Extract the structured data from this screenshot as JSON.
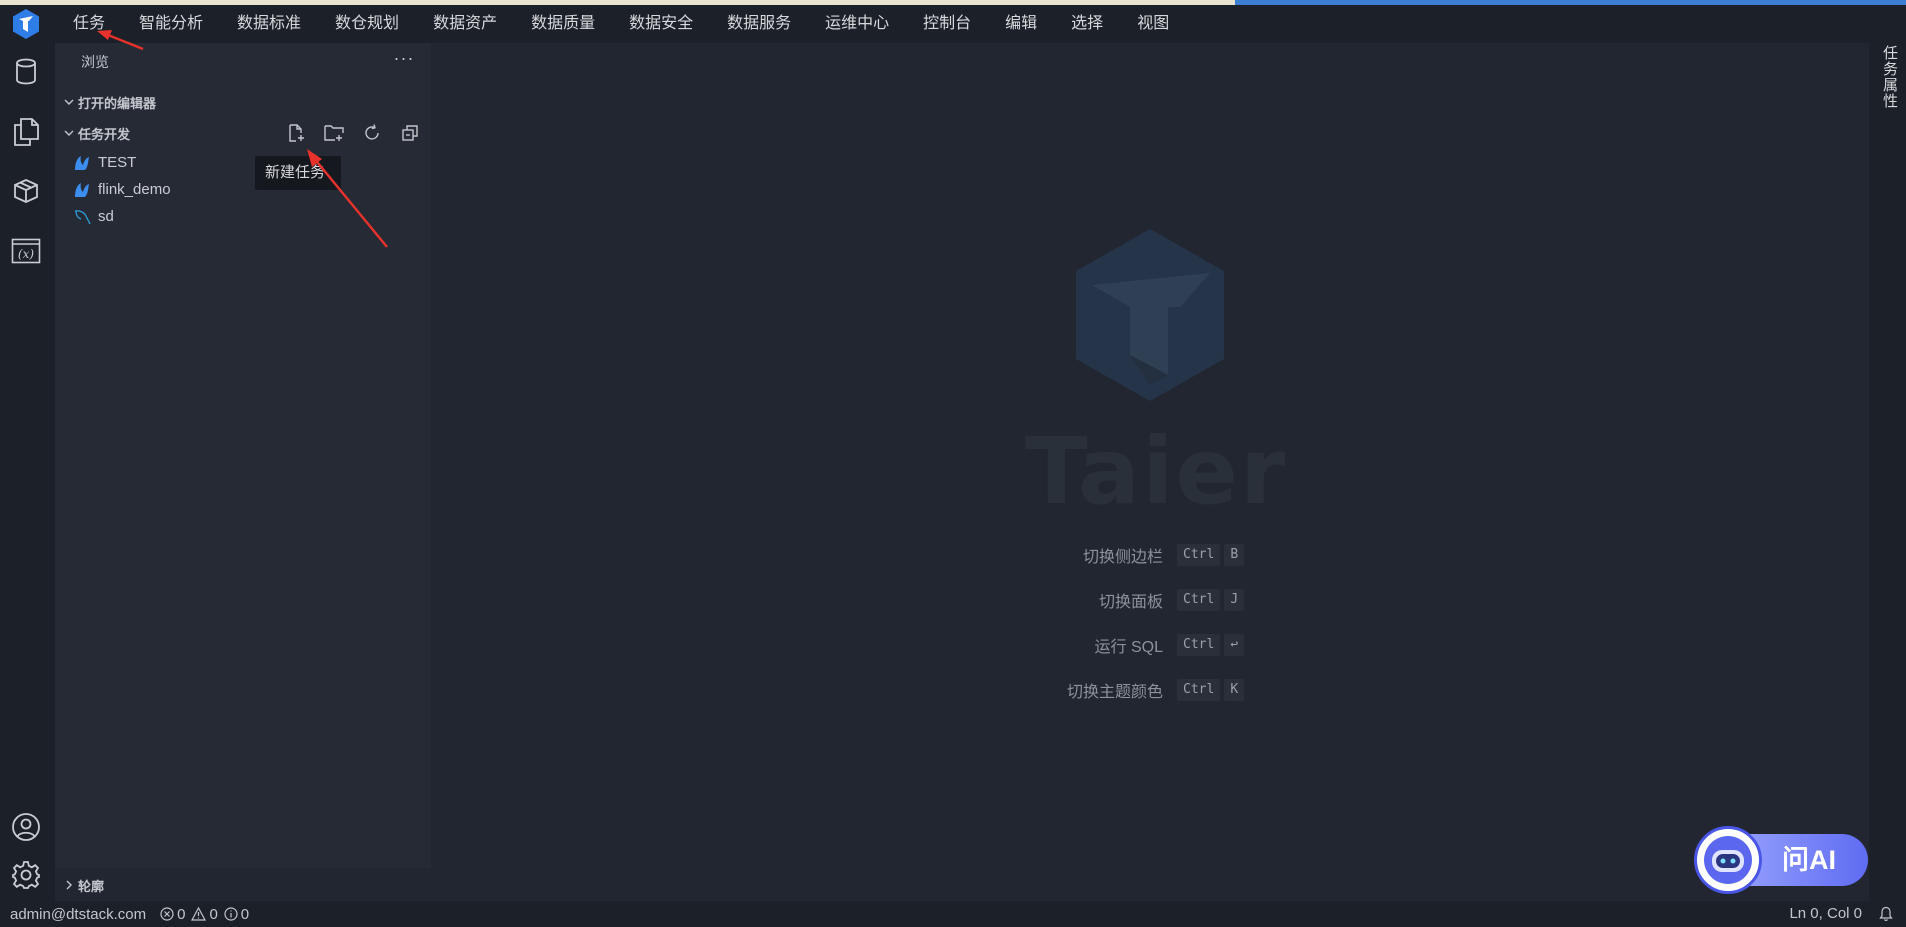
{
  "menu": {
    "items": [
      "任务",
      "智能分析",
      "数据标准",
      "数仓规划",
      "数据资产",
      "数据质量",
      "数据安全",
      "数据服务",
      "运维中心",
      "控制台",
      "编辑",
      "选择",
      "视图"
    ]
  },
  "activity": {
    "icons": [
      "database-icon",
      "files-icon",
      "package-icon",
      "variable-icon",
      "account-icon",
      "settings-icon"
    ]
  },
  "sidebar": {
    "title": "浏览",
    "more": "···",
    "open_editors": "打开的编辑器",
    "task_dev": "任务开发",
    "tree": [
      {
        "label": "TEST",
        "icon": "flink-icon"
      },
      {
        "label": "flink_demo",
        "icon": "flink-icon"
      },
      {
        "label": "sd",
        "icon": "sql-icon"
      }
    ],
    "tooltip": "新建任务",
    "outline": "轮廓"
  },
  "editor": {
    "watermark": "Taier",
    "shortcuts": [
      {
        "label": "切换侧边栏",
        "keys": [
          "Ctrl",
          "B"
        ]
      },
      {
        "label": "切换面板",
        "keys": [
          "Ctrl",
          "J"
        ]
      },
      {
        "label": "运行 SQL",
        "keys": [
          "Ctrl",
          "↩"
        ]
      },
      {
        "label": "切换主题颜色",
        "keys": [
          "Ctrl",
          "K"
        ]
      }
    ]
  },
  "auxbar": {
    "tab": "任务属性"
  },
  "ai": {
    "label": "问AI"
  },
  "status": {
    "user": "admin@dtstack.com",
    "errors": "0",
    "warnings": "0",
    "infos": "0",
    "position": "Ln 0, Col 0"
  },
  "colors": {
    "accent": "#3e7fd6",
    "background": "#212630",
    "sidebar": "#252a34",
    "annotation": "#e8322b"
  }
}
